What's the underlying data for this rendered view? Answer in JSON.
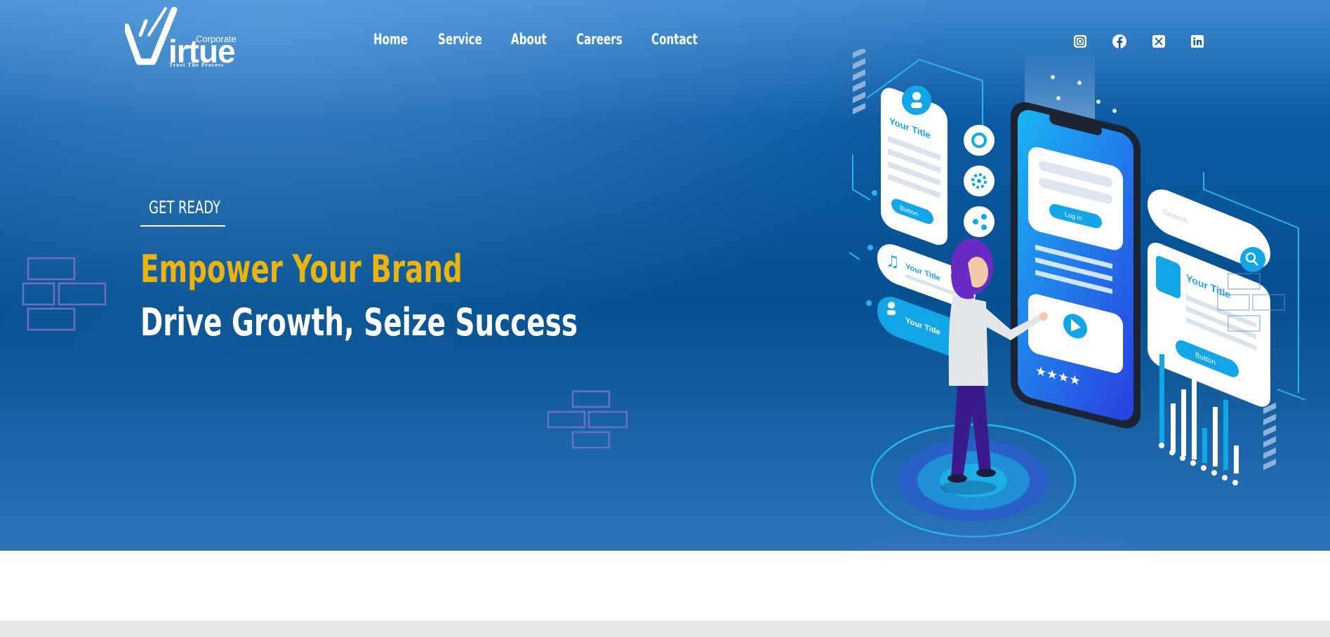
{
  "brand": {
    "small": "Corporate",
    "name": "irtue",
    "tagline": "Trust The Process"
  },
  "nav": {
    "items": [
      "Home",
      "Service",
      "About",
      "Careers",
      "Contact"
    ]
  },
  "social": [
    "instagram-icon",
    "facebook-icon",
    "x-twitter-icon",
    "linkedin-icon"
  ],
  "hero": {
    "eyebrow": "GET READY",
    "headline_1": "Empower Your Brand",
    "headline_2": "Drive Growth, Seize Success"
  },
  "illustration": {
    "card_title": "Your Title",
    "button": "Button",
    "login": "Log in",
    "search": "Search"
  },
  "colors": {
    "accent_gold": "#eab314",
    "hero_blue": "#06508f",
    "white": "#ffffff"
  }
}
